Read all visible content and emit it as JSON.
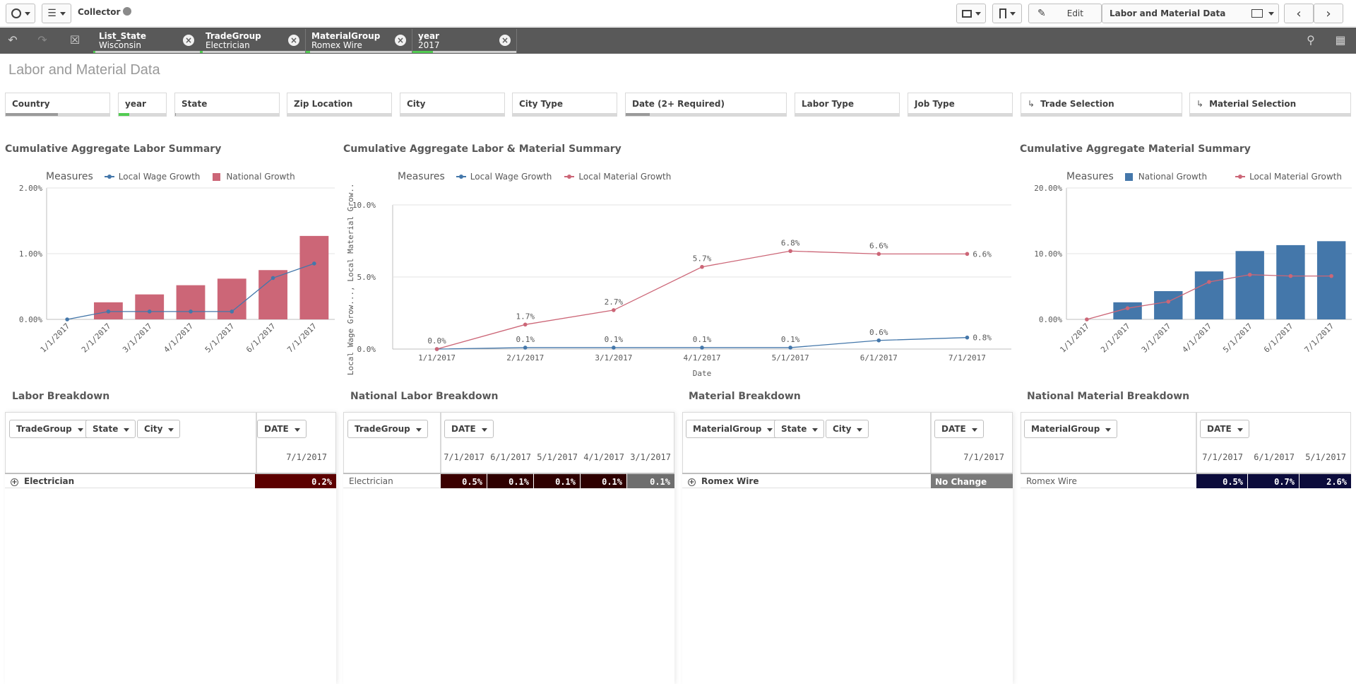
{
  "toolbar": {
    "app_name": "Collector",
    "edit_label": "Edit",
    "sheet_selector": "Labor and Material Data"
  },
  "selections": [
    {
      "field": "List_State",
      "value": "Wisconsin"
    },
    {
      "field": "TradeGroup",
      "value": "Electrician"
    },
    {
      "field": "MaterialGroup",
      "value": "Romex Wire"
    },
    {
      "field": "year",
      "value": "2017"
    }
  ],
  "sheet_title": "Labor and Material Data",
  "filters": [
    "Country",
    "year",
    "State",
    "Zip Location",
    "City",
    "City Type",
    "Date (2+ Required)",
    "Labor Type",
    "Job Type",
    "Trade Selection",
    "Material Selection"
  ],
  "colors": {
    "labor": "#4477aa",
    "national": "#cc6677",
    "material_bar": "#4477aa",
    "material_line": "#cc6677",
    "bg_dark_red": "#4a0000",
    "bg_dark_navy": "#0a0a3a"
  },
  "charts": {
    "labor": {
      "title": "Cumulative Aggregate Labor Summary",
      "legend_title": "Measures",
      "legend": [
        "Local Wage Growth",
        "National Growth"
      ]
    },
    "combined": {
      "title": "Cumulative Aggregate Labor & Material Summary",
      "legend_title": "Measures",
      "legend": [
        "Local Wage Growth",
        "Local Material Growth"
      ],
      "ylabel": "Local Wage Grow..., Local Material Grow...",
      "xlabel": "Date"
    },
    "material": {
      "title": "Cumulative Aggregate Material Summary",
      "legend_title": "Measures",
      "legend": [
        "National Growth",
        "Local Material Growth"
      ]
    }
  },
  "chart_data": [
    {
      "type": "bar",
      "title": "Cumulative Aggregate Labor Summary",
      "categories": [
        "1/1/2017",
        "2/1/2017",
        "3/1/2017",
        "4/1/2017",
        "5/1/2017",
        "6/1/2017",
        "7/1/2017"
      ],
      "y_ticks": [
        "2.00%",
        "1.00%",
        "0.00%"
      ],
      "ylim": [
        0,
        2
      ],
      "series": [
        {
          "name": "National Growth",
          "kind": "bar",
          "values": [
            0.0,
            0.26,
            0.38,
            0.52,
            0.62,
            0.75,
            1.27
          ]
        },
        {
          "name": "Local Wage Growth",
          "kind": "line",
          "values": [
            0.0,
            0.12,
            0.12,
            0.12,
            0.12,
            0.63,
            0.85
          ]
        }
      ]
    },
    {
      "type": "line",
      "title": "Cumulative Aggregate Labor & Material Summary",
      "categories": [
        "1/1/2017",
        "2/1/2017",
        "3/1/2017",
        "4/1/2017",
        "5/1/2017",
        "6/1/2017",
        "7/1/2017"
      ],
      "y_ticks": [
        "10.0%",
        "5.0%",
        "0.0%"
      ],
      "ylim": [
        0,
        10
      ],
      "xlabel": "Date",
      "series": [
        {
          "name": "Local Wage Growth",
          "values": [
            0.0,
            0.1,
            0.1,
            0.1,
            0.1,
            0.6,
            0.8
          ],
          "labels": [
            "0.0%",
            "0.1%",
            "0.1%",
            "0.1%",
            "0.1%",
            "0.6%",
            "0.8%"
          ]
        },
        {
          "name": "Local Material Growth",
          "values": [
            0.0,
            1.7,
            2.7,
            5.7,
            6.8,
            6.6,
            6.6
          ],
          "labels": [
            "",
            "1.7%",
            "2.7%",
            "5.7%",
            "6.8%",
            "6.6%",
            "6.6%"
          ]
        }
      ]
    },
    {
      "type": "bar",
      "title": "Cumulative Aggregate Material Summary",
      "categories": [
        "1/1/2017",
        "2/1/2017",
        "3/1/2017",
        "4/1/2017",
        "5/1/2017",
        "6/1/2017",
        "7/1/2017"
      ],
      "y_ticks": [
        "20.00%",
        "10.00%",
        "0.00%"
      ],
      "ylim": [
        0,
        20
      ],
      "series": [
        {
          "name": "National Growth",
          "kind": "bar",
          "values": [
            0.0,
            2.6,
            4.3,
            7.3,
            10.4,
            11.3,
            11.9
          ]
        },
        {
          "name": "Local Material Growth",
          "kind": "line",
          "values": [
            0.0,
            1.7,
            2.7,
            5.7,
            6.8,
            6.6,
            6.6
          ]
        }
      ]
    }
  ],
  "tables": {
    "labor_breakdown": {
      "title": "Labor Breakdown",
      "dims": [
        "TradeGroup",
        "State",
        "City"
      ],
      "col_dim": "DATE",
      "dates": [
        "7/1/2017"
      ],
      "row_label": "Electrician",
      "values": [
        "0.2%"
      ]
    },
    "national_labor": {
      "title": "National Labor Breakdown",
      "dims": [
        "TradeGroup"
      ],
      "col_dim": "DATE",
      "dates": [
        "7/1/2017",
        "6/1/2017",
        "5/1/2017",
        "4/1/2017",
        "3/1/2017"
      ],
      "row_label": "Electrician",
      "values": [
        "0.5%",
        "0.1%",
        "0.1%",
        "0.1%",
        "0.1%"
      ]
    },
    "material_breakdown": {
      "title": "Material Breakdown",
      "dims": [
        "MaterialGroup",
        "State",
        "City"
      ],
      "col_dim": "DATE",
      "dates": [
        "7/1/2017"
      ],
      "row_label": "Romex Wire",
      "values": [
        "No Change"
      ]
    },
    "national_material": {
      "title": "National Material Breakdown",
      "dims": [
        "MaterialGroup"
      ],
      "col_dim": "DATE",
      "dates": [
        "7/1/2017",
        "6/1/2017",
        "5/1/2017"
      ],
      "row_label": "Romex Wire",
      "values": [
        "0.5%",
        "0.7%",
        "2.6%"
      ]
    }
  }
}
